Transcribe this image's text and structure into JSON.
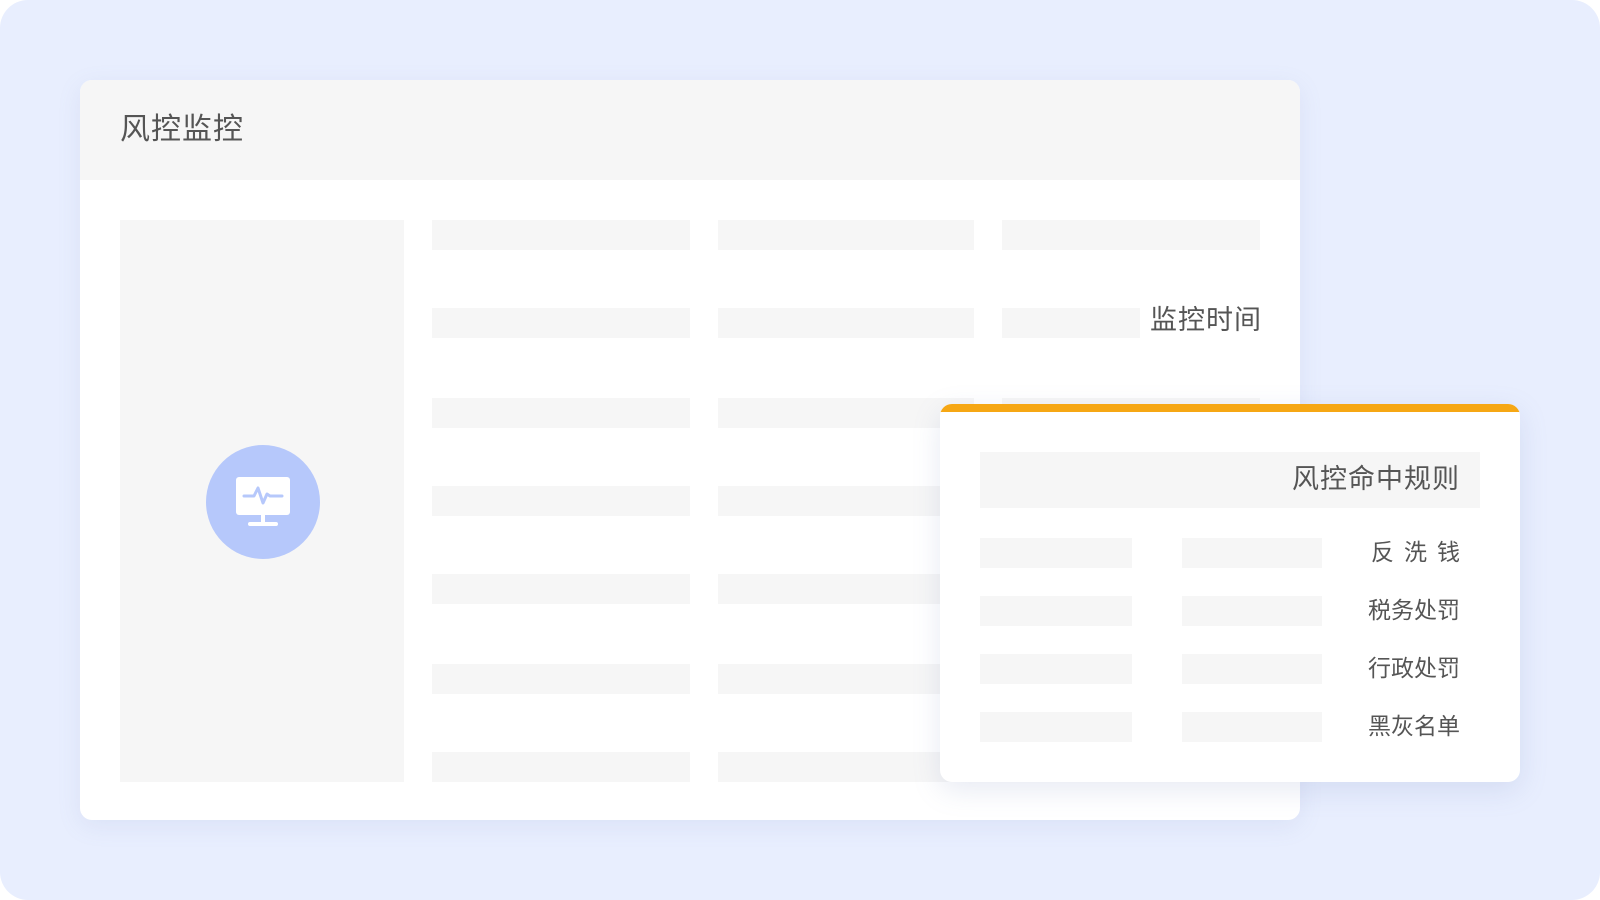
{
  "main": {
    "title": "风控监控",
    "monitor_time_label": "监控时间",
    "icon": "monitor-pulse-icon"
  },
  "rules_popup": {
    "title": "风控命中规则",
    "accent_color": "#f6a714",
    "items": [
      {
        "label": "反洗钱"
      },
      {
        "label": "税务处罚"
      },
      {
        "label": "行政处罚"
      },
      {
        "label": "黑灰名单"
      }
    ]
  },
  "colors": {
    "background": "#e8eefe",
    "placeholder": "#f6f6f6",
    "icon_badge": "#b6c8fb",
    "text": "#555555"
  }
}
